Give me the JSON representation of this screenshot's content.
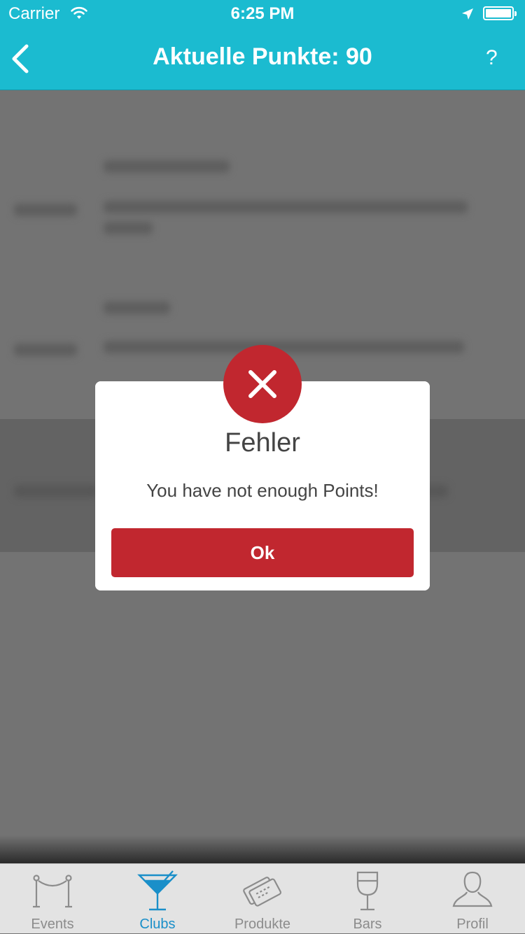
{
  "status_bar": {
    "carrier": "Carrier",
    "time": "6:25 PM",
    "icons": [
      "wifi-icon",
      "location-arrow-icon",
      "battery-icon"
    ]
  },
  "nav_bar": {
    "title": "Aktuelle Punkte: 90",
    "back_icon": "chevron-left-icon",
    "help_label": "?"
  },
  "dialog": {
    "icon": "error-x-icon",
    "title": "Fehler",
    "message": "You have not enough Points!",
    "button_label": "Ok"
  },
  "tab_bar": {
    "items": [
      {
        "label": "Events",
        "icon": "rope-barrier-icon",
        "active": false
      },
      {
        "label": "Clubs",
        "icon": "cocktail-glass-icon",
        "active": true
      },
      {
        "label": "Produkte",
        "icon": "tickets-icon",
        "active": false
      },
      {
        "label": "Bars",
        "icon": "wine-glass-icon",
        "active": false
      },
      {
        "label": "Profil",
        "icon": "person-icon",
        "active": false
      }
    ]
  },
  "colors": {
    "accent": "#1bbbd0",
    "error": "#c1272f",
    "tab_active": "#1a8fc9",
    "overlay": "#737373"
  }
}
